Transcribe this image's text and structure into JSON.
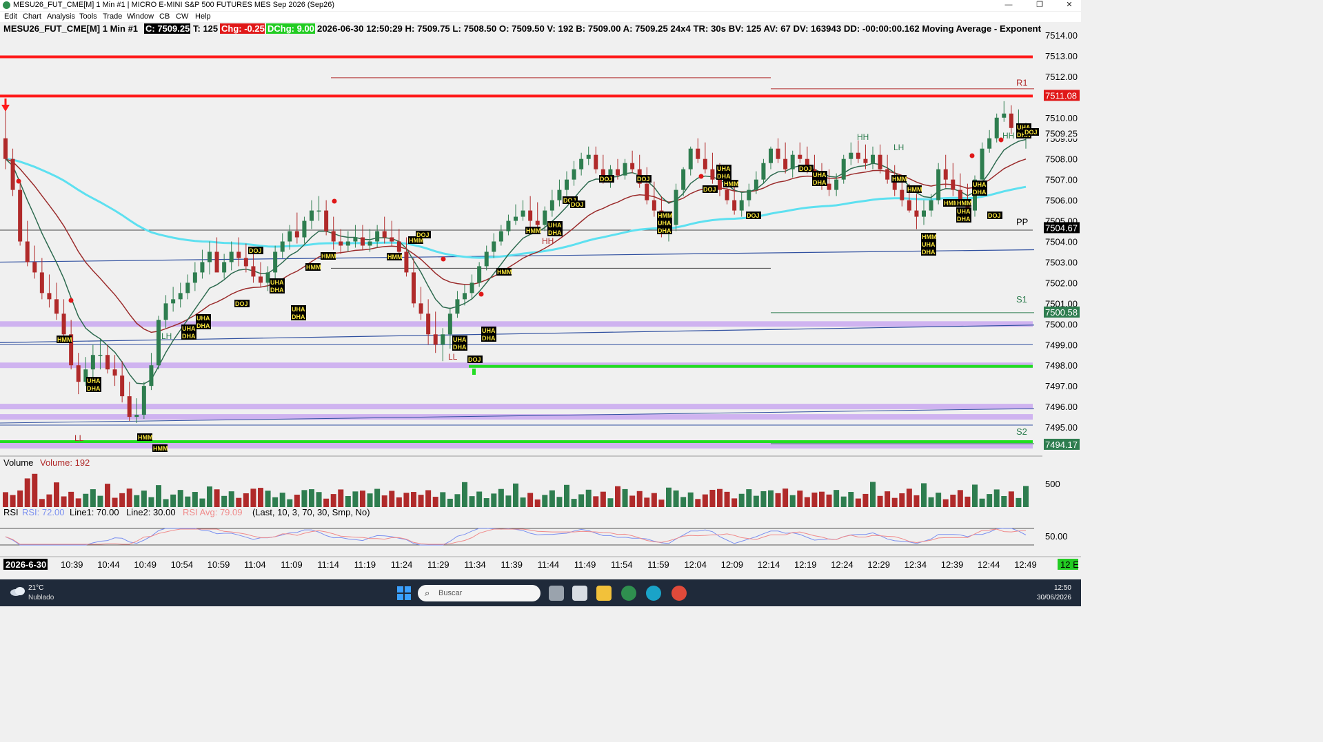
{
  "window": {
    "title": "MESU26_FUT_CME[M]   1 Min   #1 | MICRO E-MINI S&P 500 FUTURES MES Sep 2026 (Sep26)",
    "minimize": "—",
    "maximize": "❐",
    "close": "✕"
  },
  "menu": [
    "Edit",
    "Chart",
    "Analysis",
    "Tools",
    "Trade",
    "Window",
    "CB",
    "CW",
    "Help"
  ],
  "header": {
    "symbol": "MESU26_FUT_CME[M]  1 Min  #1",
    "close": "C: 7509.25",
    "ticks": "T: 125",
    "chg": "Chg: -0.25",
    "dchg": "DChg: 9.00",
    "rest": "2026-06-30 12:50:29  H: 7509.75  L: 7508.50  O: 7509.50  V: 192  B: 7509.00  A: 7509.25  24x4  TR: 30s  BV: 125  AV: 67  DV: 163943  DD: -00:00:00.162  Moving Average - Exponent"
  },
  "price_axis": {
    "labels": [
      "7514.00",
      "7513.00",
      "7512.00",
      "7511.00",
      "7510.00",
      "7509.00",
      "7508.00",
      "7507.00",
      "7506.00",
      "7505.00",
      "7504.00",
      "7503.00",
      "7502.00",
      "7501.00",
      "7500.00",
      "7499.00",
      "7498.00",
      "7497.00",
      "7496.00",
      "7495.00"
    ],
    "current_price": "7509.25",
    "levels": [
      {
        "name": "R1",
        "label": "R1",
        "price_tag": "7511.08",
        "price": 7511.08
      },
      {
        "name": "PP",
        "label": "PP",
        "price_tag": "7504.67",
        "price": 7504.67
      },
      {
        "name": "S1",
        "label": "S1",
        "price_tag": "7500.58",
        "price": 7500.58
      },
      {
        "name": "S2",
        "label": "S2",
        "price_tag": "7494.17",
        "price": 7494.17
      }
    ]
  },
  "time_axis": {
    "start_label": "2026-6-30",
    "labels": [
      "10:39",
      "10:44",
      "10:49",
      "10:54",
      "10:59",
      "11:04",
      "11:09",
      "11:14",
      "11:19",
      "11:24",
      "11:29",
      "11:34",
      "11:39",
      "11:44",
      "11:49",
      "11:54",
      "11:59",
      "12:04",
      "12:09",
      "12:14",
      "12:19",
      "12:24",
      "12:29",
      "12:34",
      "12:39",
      "12:44",
      "12:49"
    ],
    "corner": "12 E"
  },
  "swing_labels": [
    "LL",
    "LH",
    "LL",
    "HH",
    "LH",
    "HH",
    "HH"
  ],
  "volume": {
    "title": "Volume",
    "value_label": "Volume: 192",
    "axis_label": "500"
  },
  "rsi": {
    "title": "RSI",
    "rsi_value": "RSI: 72.00",
    "line1": "Line1: 70.00",
    "line2": "Line2: 30.00",
    "avg": "RSI Avg: 79.09",
    "params": "(Last, 10, 3, 70, 30, Smp, No)",
    "axis_label": "50.00"
  },
  "taskbar": {
    "weather_temp": "21°C",
    "weather_desc": "Nublado",
    "search_placeholder": "Buscar",
    "time": "12:50",
    "date": "30/06/2026"
  },
  "colors": {
    "up": "#2e7d4f",
    "down": "#b02a2a",
    "bg": "#f0f0f0",
    "resistance": "#ff1a1a",
    "support": "#22dd22",
    "zone": "#c9a8f0",
    "ema_fast": "#2d6a4f",
    "ema_slow": "#9b2c2c",
    "ema_cyan": "#5de0f0",
    "trend": "#3050a0"
  },
  "chart_data": {
    "type": "candlestick",
    "interval": "1 Min",
    "ylim": [
      7493.5,
      7514.5
    ],
    "x": [
      "10:34",
      "10:35",
      "10:36",
      "10:37",
      "10:38",
      "10:39",
      "10:40",
      "10:41",
      "10:42",
      "10:43",
      "10:44",
      "10:45",
      "10:46",
      "10:47",
      "10:48",
      "10:49",
      "10:50",
      "10:51",
      "10:52",
      "10:53",
      "10:54",
      "10:55",
      "10:56",
      "10:57",
      "10:58",
      "10:59",
      "11:00",
      "11:01",
      "11:02",
      "11:03",
      "11:04",
      "11:05",
      "11:06",
      "11:07",
      "11:08",
      "11:09",
      "11:10",
      "11:11",
      "11:12",
      "11:13",
      "11:14",
      "11:15",
      "11:16",
      "11:17",
      "11:18",
      "11:19",
      "11:20",
      "11:21",
      "11:22",
      "11:23",
      "11:24",
      "11:25",
      "11:26",
      "11:27",
      "11:28",
      "11:29",
      "11:30",
      "11:31",
      "11:32",
      "11:33",
      "11:34",
      "11:35",
      "11:36",
      "11:37",
      "11:38",
      "11:39",
      "11:40",
      "11:41",
      "11:42",
      "11:43",
      "11:44",
      "11:45",
      "11:46",
      "11:47",
      "11:48",
      "11:49",
      "11:50",
      "11:51",
      "11:52",
      "11:53",
      "11:54",
      "11:55",
      "11:56",
      "11:57",
      "11:58",
      "11:59",
      "12:00",
      "12:01",
      "12:02",
      "12:03",
      "12:04",
      "12:05",
      "12:06",
      "12:07",
      "12:08",
      "12:09",
      "12:10",
      "12:11",
      "12:12",
      "12:13",
      "12:14",
      "12:15",
      "12:16",
      "12:17",
      "12:18",
      "12:19",
      "12:20",
      "12:21",
      "12:22",
      "12:23",
      "12:24",
      "12:25",
      "12:26",
      "12:27",
      "12:28",
      "12:29",
      "12:30",
      "12:31",
      "12:32",
      "12:33",
      "12:34",
      "12:35",
      "12:36",
      "12:37",
      "12:38",
      "12:39",
      "12:40",
      "12:41",
      "12:42",
      "12:43",
      "12:44",
      "12:45",
      "12:46",
      "12:47",
      "12:48",
      "12:49",
      "12:50"
    ],
    "open": [
      7509.0,
      7508.0,
      7506.5,
      7504.0,
      7503.0,
      7502.5,
      7501.5,
      7501.2,
      7500.5,
      7499.5,
      7498.0,
      7497.2,
      7497.8,
      7498.5,
      7498.5,
      7497.8,
      7497.5,
      7496.5,
      7495.5,
      7495.6,
      7497.0,
      7498.0,
      7500.2,
      7501.0,
      7501.2,
      7501.5,
      7502.0,
      7502.5,
      7503.0,
      7503.5,
      7502.5,
      7503.0,
      7503.5,
      7503.2,
      7502.8,
      7502.3,
      7502.0,
      7502.5,
      7503.5,
      7504.0,
      7504.5,
      7504.2,
      7505.0,
      7505.5,
      7505.5,
      7504.5,
      7504.0,
      7503.8,
      7504.0,
      7504.2,
      7503.8,
      7504.0,
      7504.5,
      7504.2,
      7504.0,
      7503.5,
      7502.5,
      7501.0,
      7500.5,
      7499.5,
      7499.0,
      7499.5,
      7500.5,
      7501.2,
      7501.5,
      7502.0,
      7502.8,
      7503.5,
      7504.0,
      7504.5,
      7505.0,
      7505.2,
      7505.5,
      7505.0,
      7504.8,
      7505.5,
      7506.0,
      7506.5,
      7507.0,
      7507.5,
      7508.0,
      7508.2,
      7507.5,
      7507.0,
      7507.5,
      7507.2,
      7507.8,
      7507.5,
      7506.8,
      7506.0,
      7505.5,
      7504.5,
      7504.8,
      7506.5,
      7507.5,
      7508.5,
      7508.0,
      7507.5,
      7507.0,
      7506.5,
      7506.0,
      7505.5,
      7506.0,
      7506.5,
      7507.0,
      7507.8,
      7508.5,
      7508.0,
      7507.5,
      7508.2,
      7508.0,
      7507.5,
      7507.0,
      7506.8,
      7506.5,
      7507.0,
      7508.0,
      7508.3,
      7508.0,
      7507.8,
      7508.2,
      7507.5,
      7507.0,
      7506.5,
      7506.0,
      7505.5,
      7505.2,
      7505.5,
      7506.0,
      7507.5,
      7507.0,
      7506.5,
      7506.0,
      7505.5,
      7507.0,
      7508.5,
      7509.0,
      7510.0,
      7510.2,
      7509.5,
      7509.25
    ],
    "high": [
      7510.5,
      7508.5,
      7507.0,
      7505.0,
      7503.8,
      7503.2,
      7502.4,
      7502.0,
      7501.2,
      7500.2,
      7498.6,
      7498.4,
      7499.0,
      7499.3,
      7499.0,
      7498.5,
      7498.2,
      7497.2,
      7496.4,
      7497.2,
      7498.6,
      7500.4,
      7501.4,
      7501.8,
      7502.0,
      7502.4,
      7503.0,
      7503.6,
      7504.0,
      7504.2,
      7503.4,
      7504.0,
      7504.2,
      7503.9,
      7503.4,
      7503.0,
      7502.8,
      7503.8,
      7504.4,
      7504.8,
      7505.4,
      7505.2,
      7506.0,
      7506.2,
      7506.0,
      7505.2,
      7504.6,
      7504.5,
      7504.8,
      7504.8,
      7504.6,
      7504.8,
      7505.2,
      7505.0,
      7504.6,
      7504.2,
      7503.2,
      7501.8,
      7501.2,
      7500.6,
      7499.8,
      7500.8,
      7501.6,
      7501.9,
      7502.4,
      7503.0,
      7503.8,
      7504.4,
      7504.8,
      7505.3,
      7505.8,
      7506.0,
      7506.2,
      7505.9,
      7505.7,
      7506.5,
      7507.0,
      7507.4,
      7507.9,
      7508.3,
      7508.6,
      7508.6,
      7508.2,
      7507.7,
      7508.0,
      7508.0,
      7508.4,
      7508.2,
      7507.6,
      7506.9,
      7506.2,
      7505.4,
      7506.8,
      7507.6,
      7508.6,
      7509.0,
      7508.8,
      7508.3,
      7507.8,
      7507.3,
      7506.8,
      7506.4,
      7506.8,
      7507.4,
      7508.0,
      7508.6,
      7509.0,
      7508.8,
      7508.4,
      7508.8,
      7508.6,
      7508.2,
      7507.8,
      7507.5,
      7507.3,
      7508.2,
      7508.8,
      7508.9,
      7508.7,
      7508.6,
      7508.7,
      7508.2,
      7507.7,
      7507.2,
      7506.8,
      7506.3,
      7506.0,
      7506.3,
      7507.8,
      7508.2,
      7507.8,
      7507.3,
      7506.8,
      7507.2,
      7508.8,
      7509.4,
      7510.2,
      7510.8,
      7510.6,
      7510.4,
      7509.75
    ],
    "low": [
      7507.5,
      7506.2,
      7503.8,
      7502.8,
      7502.2,
      7501.2,
      7500.8,
      7500.2,
      7499.2,
      7497.8,
      7496.6,
      7497.0,
      7497.4,
      7497.8,
      7497.6,
      7497.0,
      7496.2,
      7495.3,
      7495.2,
      7495.4,
      7496.8,
      7497.8,
      7499.8,
      7500.6,
      7500.8,
      7501.2,
      7501.6,
      7502.2,
      7502.4,
      7502.6,
      7502.2,
      7502.6,
      7502.8,
      7502.5,
      7502.0,
      7501.8,
      7501.6,
      7502.2,
      7503.2,
      7503.6,
      7503.9,
      7503.9,
      7504.6,
      7505.0,
      7504.3,
      7503.6,
      7503.4,
      7503.5,
      7503.7,
      7503.6,
      7503.5,
      7503.7,
      7503.9,
      7503.8,
      7503.2,
      7502.3,
      7500.8,
      7500.2,
      7499.0,
      7498.6,
      7498.2,
      7498.8,
      7500.3,
      7500.9,
      7501.2,
      7501.8,
      7502.6,
      7503.2,
      7503.8,
      7504.3,
      7504.8,
      7505.0,
      7504.6,
      7504.4,
      7504.5,
      7505.2,
      7505.7,
      7506.2,
      7506.7,
      7507.2,
      7507.7,
      7507.3,
      7506.8,
      7506.6,
      7507.0,
      7507.0,
      7507.3,
      7506.6,
      7505.8,
      7505.2,
      7504.2,
      7504.0,
      7504.5,
      7506.2,
      7507.2,
      7507.8,
      7507.3,
      7506.8,
      7506.2,
      7505.8,
      7505.3,
      7505.2,
      7505.7,
      7506.3,
      7506.8,
      7507.5,
      7507.8,
      7507.3,
      7507.1,
      7507.8,
      7507.3,
      7506.8,
      7506.5,
      7506.2,
      7506.2,
      7506.8,
      7507.7,
      7507.8,
      7507.5,
      7507.5,
      7507.3,
      7506.8,
      7506.2,
      7505.7,
      7505.4,
      7504.6,
      7504.8,
      7505.2,
      7505.8,
      7506.6,
      7506.2,
      7505.7,
      7505.3,
      7505.2,
      7506.8,
      7508.3,
      7508.8,
      7509.8,
      7509.2,
      7509.0,
      7508.5
    ],
    "close": [
      7508.0,
      7506.5,
      7504.0,
      7503.0,
      7502.5,
      7501.5,
      7501.2,
      7500.5,
      7499.5,
      7498.0,
      7497.2,
      7497.8,
      7498.5,
      7498.5,
      7497.8,
      7497.5,
      7496.5,
      7495.5,
      7495.6,
      7497.0,
      7498.0,
      7500.2,
      7501.0,
      7501.2,
      7501.5,
      7502.0,
      7502.5,
      7503.0,
      7503.5,
      7502.5,
      7503.0,
      7503.5,
      7503.2,
      7502.8,
      7502.3,
      7502.0,
      7502.5,
      7503.5,
      7504.0,
      7504.5,
      7504.2,
      7505.0,
      7505.5,
      7505.5,
      7504.5,
      7504.0,
      7503.8,
      7504.0,
      7504.2,
      7503.8,
      7504.0,
      7504.5,
      7504.2,
      7504.0,
      7503.5,
      7502.5,
      7501.0,
      7500.5,
      7499.5,
      7499.0,
      7499.5,
      7500.5,
      7501.2,
      7501.5,
      7502.0,
      7502.8,
      7503.5,
      7504.0,
      7504.5,
      7505.0,
      7505.2,
      7505.5,
      7505.0,
      7504.8,
      7505.5,
      7506.0,
      7506.5,
      7507.0,
      7507.5,
      7508.0,
      7508.2,
      7507.5,
      7507.0,
      7507.5,
      7507.2,
      7507.8,
      7507.5,
      7506.8,
      7506.0,
      7505.5,
      7504.5,
      7504.8,
      7506.5,
      7507.5,
      7508.5,
      7508.0,
      7507.5,
      7507.0,
      7506.5,
      7506.0,
      7505.5,
      7506.0,
      7506.5,
      7507.0,
      7507.8,
      7508.5,
      7508.0,
      7507.5,
      7508.2,
      7508.0,
      7507.5,
      7507.0,
      7506.8,
      7506.5,
      7507.0,
      7508.0,
      7508.3,
      7508.0,
      7507.8,
      7508.2,
      7507.5,
      7507.0,
      7506.5,
      7506.0,
      7505.5,
      7505.2,
      7505.5,
      7506.0,
      7507.5,
      7507.0,
      7506.5,
      7506.0,
      7505.5,
      7507.0,
      7508.5,
      7509.0,
      7510.0,
      7510.2,
      7509.5,
      7509.5,
      7509.25
    ],
    "volume_max_label": "500",
    "volume_last": 192,
    "rsi_last": 72.0,
    "rsi_avg_last": 79.09,
    "rsi_lines": [
      70,
      30
    ],
    "horizontal_levels": [
      {
        "name": "resistance-1",
        "price": 7512.95,
        "color": "#ff1a1a"
      },
      {
        "name": "resistance-2",
        "price": 7511.05,
        "color": "#ff1a1a"
      },
      {
        "name": "support-1",
        "price": 7497.95,
        "color": "#22dd22"
      },
      {
        "name": "support-2",
        "price": 7494.3,
        "color": "#22dd22"
      }
    ],
    "zones": [
      7500.0,
      7498.0,
      7496.0,
      7495.5,
      7494.1
    ]
  }
}
